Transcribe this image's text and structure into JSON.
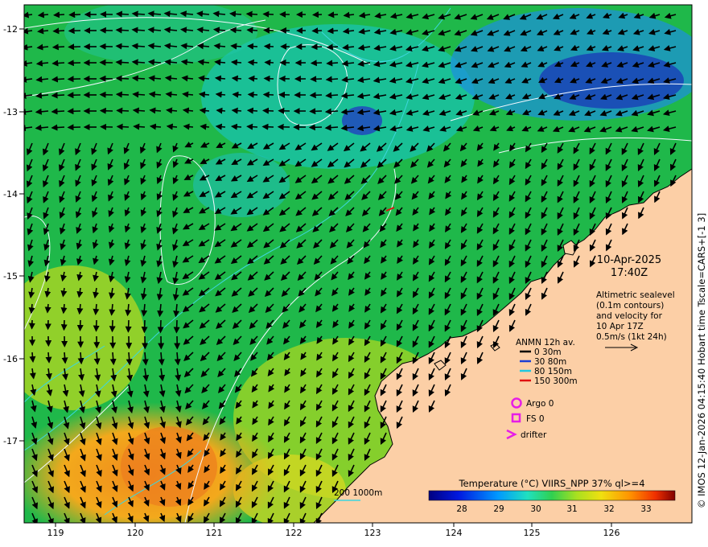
{
  "map": {
    "lat_ticks": [
      "-12",
      "-13",
      "-14",
      "-15",
      "-16",
      "-17"
    ],
    "lon_ticks": [
      "119",
      "120",
      "121",
      "122",
      "123",
      "124",
      "125",
      "126"
    ],
    "colors": {
      "land": "#fccfa6",
      "cool": "#2a4fd0",
      "mid": "#1fb84a",
      "warm": "#f2a21a",
      "contour": "#f4f8ff",
      "isobath": "#3dd6dd",
      "arrow": "#000000"
    }
  },
  "annotations": {
    "date": "10-Apr-2025",
    "time": "17:40Z",
    "altimetry_lines": [
      "Altimetric sealevel",
      "(0.1m contours)",
      "and velocity for",
      "10 Apr 17Z",
      "0.5m/s (1kt 24h)"
    ]
  },
  "legend": {
    "title": "ANMN 12h av.",
    "depths": [
      {
        "label": "0 30m",
        "color": "#000000"
      },
      {
        "label": "30 80m",
        "color": "#1a3fd4"
      },
      {
        "label": "80 150m",
        "color": "#20c8e0"
      },
      {
        "label": "150 300m",
        "color": "#e01010"
      }
    ],
    "argo": "Argo 0",
    "fs": "FS 0",
    "drifter": "drifter",
    "marker_color": "#e61ee6"
  },
  "bathy_label": "200  1000m",
  "colorbar": {
    "title": "Temperature (°C) VIIRS_NPP 37% ql>=4",
    "ticks": [
      "28",
      "29",
      "30",
      "31",
      "32",
      "33"
    ]
  },
  "side_credit": "© IMOS 12-Jan-2026 04:15:40 Hobart time Tscale=CARS+[-1 3]"
}
